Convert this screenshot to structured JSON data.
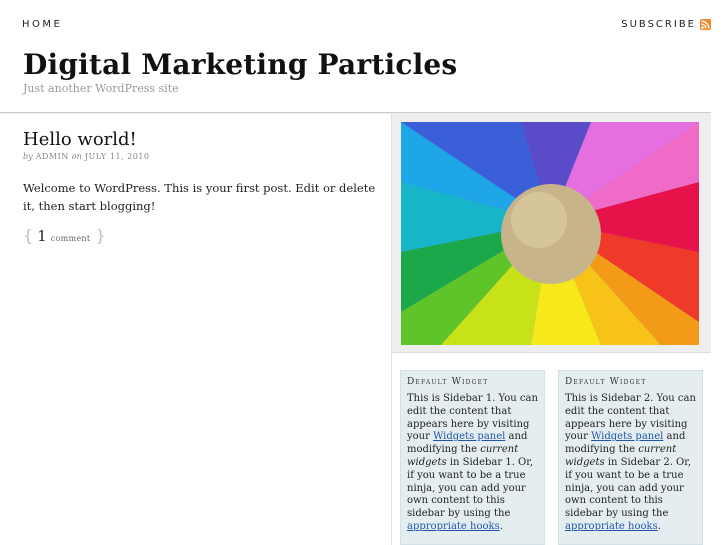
{
  "nav": {
    "home": "HOME",
    "subscribe": "SUBSCRIBE"
  },
  "header": {
    "title": "Digital Marketing Particles",
    "tagline": "Just another WordPress site"
  },
  "post": {
    "title": "Hello world!",
    "meta_by": "by",
    "author": "admin",
    "meta_on": "on",
    "date": "July 11, 2010",
    "body": "Welcome to WordPress. This is your first post. Edit or delete it, then start blogging!",
    "comment_open": "{",
    "comment_count": "1",
    "comment_label": "comment",
    "comment_close": "}"
  },
  "feature_image": {
    "alt_icon": "colorful-pinwheel-image"
  },
  "widgets": [
    {
      "title": "Default Widget",
      "text_1": "This is Sidebar 1. You can edit the content that appears here by visiting your ",
      "link_1": "Widgets panel",
      "text_2": " and modifying the ",
      "em": "current widgets",
      "text_3": " in Sidebar 1. Or, if you want to be a true ninja, you can add your own content to this sidebar by using the ",
      "link_2": "appropriate hooks",
      "text_4": "."
    },
    {
      "title": "Default Widget",
      "text_1": "This is Sidebar 2. You can edit the content that appears here by visiting your ",
      "link_1": "Widgets panel",
      "text_2": " and modifying the ",
      "em": "current widgets",
      "text_3": " in Sidebar 2. Or, if you want to be a true ninja, you can add your own content to this sidebar by using the ",
      "link_2": "appropriate hooks",
      "text_4": "."
    }
  ],
  "colors": {
    "link": "#2255aa",
    "widget_bg": "#e4eef0",
    "rss": "#f08c2c"
  }
}
